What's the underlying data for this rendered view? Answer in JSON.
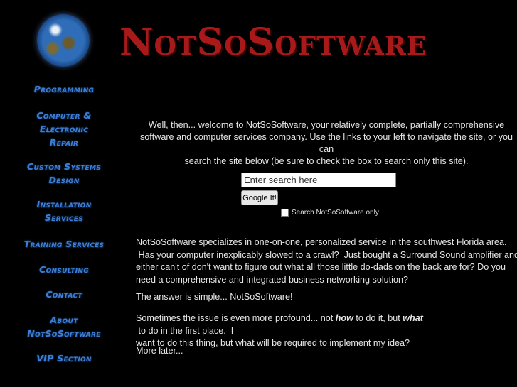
{
  "header": {
    "title": "NotSoSoftware"
  },
  "sidebar": {
    "logo": "globe-icon",
    "items": [
      {
        "lines": [
          "Programming"
        ]
      },
      {
        "lines": [
          "Computer &",
          "Electronic",
          "Repair"
        ]
      },
      {
        "lines": [
          "Custom Systems",
          "Design"
        ]
      },
      {
        "lines": [
          "Installation",
          "Services"
        ]
      },
      {
        "lines": [
          "Training Services"
        ]
      },
      {
        "lines": [
          "Consulting"
        ]
      },
      {
        "lines": [
          "Contact"
        ]
      },
      {
        "lines": [
          "About",
          "NotSoSoftware"
        ]
      },
      {
        "lines": [
          "VIP Section"
        ]
      }
    ]
  },
  "main": {
    "welcome": {
      "lines": [
        "Well, then... welcome to NotSoSoftware, your relatively complete, partially comprehensive",
        "software and computer services company.  Use the links to your left to navigate the site, or you can",
        "search the site below (be sure to check the box to search only this site)."
      ]
    },
    "search": {
      "value": "Enter search here",
      "button_label": "Google It!",
      "checkbox_label": "Search NotSoSoftware only",
      "checked": false
    },
    "paragraphs": {
      "p1": [
        "NotSoSoftware specializes in one-on-one, personalized service in the southwest Florida area.",
        " Has your computer inexplicably slowed to a crawl?  Just bought a Surround Sound amplifier and",
        "either can't of don't want to figure out what all those little do-dads on the back are for?  Do you",
        "need a comprehensive and integrated business networking solution?"
      ],
      "p2": "The answer is simple... NotSoSoftware!",
      "p3": {
        "pre": "Sometimes the issue is even more profound... not ",
        "em1": "how",
        "mid": " to do it, but ",
        "em2": "what",
        "post": " to do in the first place.  I",
        "line2": "want to do this thing, but what will be required to implement my idea?"
      },
      "p4": "More later..."
    }
  }
}
